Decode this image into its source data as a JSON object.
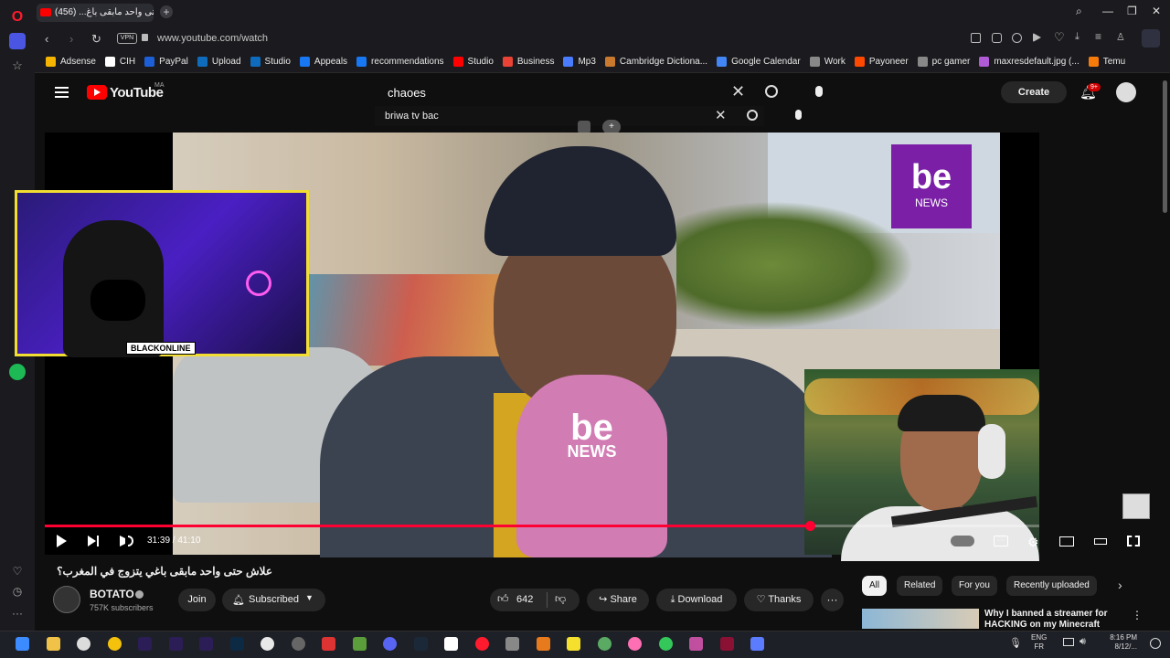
{
  "browser": {
    "tab_title": "علاش حتى واحد مابقى باغ... (456)",
    "url": "www.youtube.com/watch",
    "vpn_label": "VPN",
    "bookmarks": [
      {
        "label": "Adsense",
        "color": "#f4b400"
      },
      {
        "label": "CIH",
        "color": "#ffffff"
      },
      {
        "label": "PayPal",
        "color": "#1d5fd6"
      },
      {
        "label": "Upload",
        "color": "#0f6cbd"
      },
      {
        "label": "Studio",
        "color": "#0f6cbd"
      },
      {
        "label": "Appeals",
        "color": "#1877f2"
      },
      {
        "label": "recommendations",
        "color": "#1877f2"
      },
      {
        "label": "Studio",
        "color": "#ff0000"
      },
      {
        "label": "Business",
        "color": "#ea4335"
      },
      {
        "label": "Mp3",
        "color": "#4a7cff"
      },
      {
        "label": "Cambridge Dictiona...",
        "color": "#c97a2e"
      },
      {
        "label": "Google Calendar",
        "color": "#4285f4"
      },
      {
        "label": "Work",
        "color": "#888888"
      },
      {
        "label": "Payoneer",
        "color": "#ff4800"
      },
      {
        "label": "pc gamer",
        "color": "#888888"
      },
      {
        "label": "maxresdefault.jpg (...",
        "color": "#b05ad6"
      },
      {
        "label": "Temu",
        "color": "#f77b0a"
      }
    ]
  },
  "youtube": {
    "logo_text": "YouTube",
    "country_code": "MA",
    "search_query": "chaoes",
    "search_query_secondary": "briwa tv bac",
    "create_label": "Create",
    "notif_count": "9+"
  },
  "player": {
    "time_display": "31:39 / 41:10",
    "progress": 0.769,
    "overlay_streamer_name": "BLACKONLINE",
    "video_brand_top": "be",
    "video_brand_bottom": "NEWS",
    "cc_label": "CC"
  },
  "video": {
    "title": "علاش حتى واحد مابقى باغي يتزوج في المغرب؟",
    "channel_name": "BOTATO",
    "subscribers": "757K subscribers",
    "join_label": "Join",
    "subscribed_label": "Subscribed",
    "like_count": "642",
    "share_label": "Share",
    "download_label": "Download",
    "thanks_label": "Thanks"
  },
  "sidebar": {
    "chips": [
      "All",
      "Related",
      "For you",
      "Recently uploaded"
    ],
    "rec_title": "Why I banned a streamer for HACKING on my Minecraft"
  },
  "taskbar": {
    "lang_top": "ENG",
    "lang_bottom": "FR",
    "time": "8:16 PM",
    "date": "8/12/..."
  }
}
